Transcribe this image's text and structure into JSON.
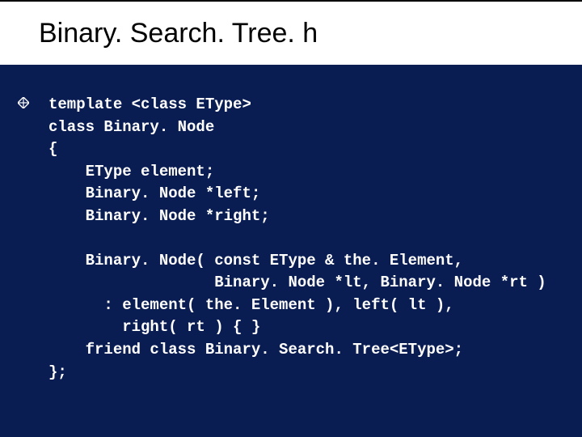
{
  "title": "Binary. Search. Tree. h",
  "code": {
    "l1": "template <class EType>",
    "l2": "class Binary. Node",
    "l3": "{",
    "l4": "    EType element;",
    "l5": "    Binary. Node *left;",
    "l6": "    Binary. Node *right;",
    "l7": "",
    "l8": "    Binary. Node( const EType & the. Element,",
    "l9": "                  Binary. Node *lt, Binary. Node *rt )",
    "l10": "      : element( the. Element ), left( lt ),",
    "l11": "        right( rt ) { }",
    "l12": "    friend class Binary. Search. Tree<EType>;",
    "l13": "};"
  }
}
